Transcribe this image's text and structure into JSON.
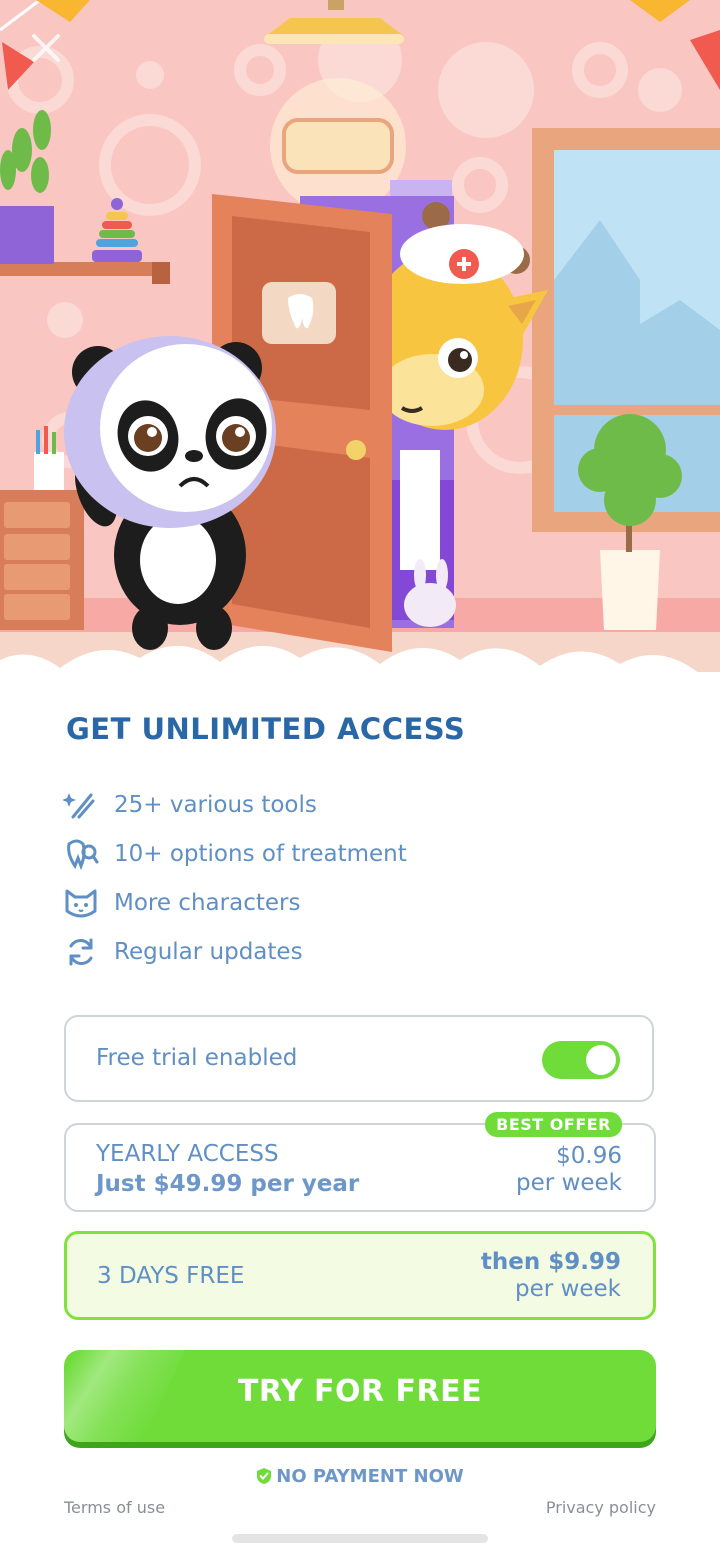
{
  "headline": "GET UNLIMITED ACCESS",
  "features": [
    {
      "icon": "magic-tools-icon",
      "label": "25+ various tools"
    },
    {
      "icon": "tooth-magnifier-icon",
      "label": "10+ options of treatment"
    },
    {
      "icon": "cat-face-icon",
      "label": "More characters"
    },
    {
      "icon": "refresh-icon",
      "label": "Regular updates"
    }
  ],
  "trial_toggle": {
    "label": "Free trial enabled",
    "enabled": true
  },
  "plans": {
    "yearly": {
      "name": "YEARLY ACCESS",
      "subtitle": "Just $49.99 per year",
      "price": "$0.96",
      "period": "per week",
      "badge": "BEST OFFER"
    },
    "trial": {
      "name": "3 DAYS FREE",
      "price": "then $9.99",
      "period": "per week"
    }
  },
  "cta_label": "TRY FOR FREE",
  "no_payment": "NO PAYMENT NOW",
  "footer": {
    "terms": "Terms of use",
    "privacy": "Privacy policy"
  },
  "colors": {
    "accent_green": "#6fdc3a",
    "headline_blue": "#2a67a6",
    "text_blue": "#5f8fc4",
    "wall_pink": "#f9c6c2"
  }
}
